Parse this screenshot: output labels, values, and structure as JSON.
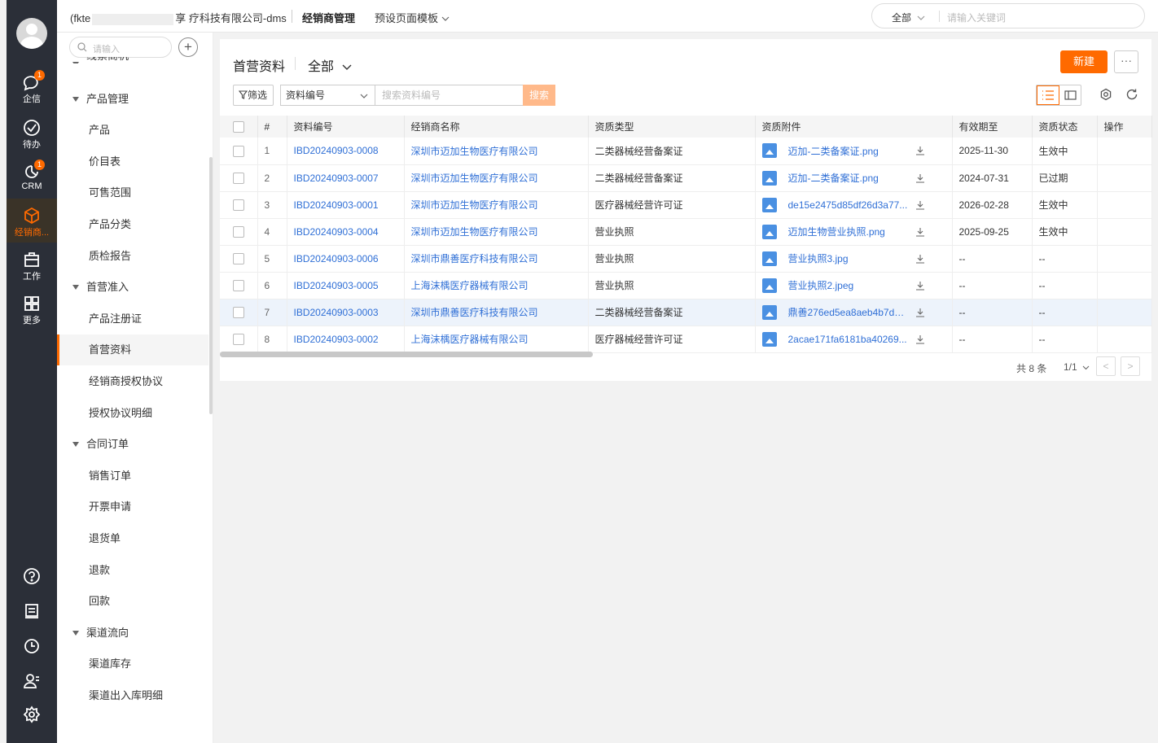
{
  "topbar": {
    "company_prefix": "(fkte",
    "company_suffix": "享 疗科技有限公司-dms",
    "nav_active": "经销商管理",
    "nav_template": "预设页面模板",
    "search_scope": "全部",
    "search_placeholder": "请输入关键词"
  },
  "rail": {
    "items": [
      {
        "label": "企信",
        "badge": "1"
      },
      {
        "label": "待办"
      },
      {
        "label": "CRM",
        "badge": "1"
      },
      {
        "label": "经销商..."
      },
      {
        "label": "工作"
      },
      {
        "label": "更多"
      }
    ]
  },
  "sidebar": {
    "search_placeholder": "请输入",
    "add_label": "+",
    "items": [
      {
        "label": "线索商机",
        "type": "group"
      },
      {
        "label": "产品管理",
        "type": "group"
      },
      {
        "label": "产品",
        "type": "child"
      },
      {
        "label": "价目表",
        "type": "child"
      },
      {
        "label": "可售范围",
        "type": "child"
      },
      {
        "label": "产品分类",
        "type": "child"
      },
      {
        "label": "质检报告",
        "type": "child"
      },
      {
        "label": "首营准入",
        "type": "group"
      },
      {
        "label": "产品注册证",
        "type": "child"
      },
      {
        "label": "首营资料",
        "type": "child",
        "active": true
      },
      {
        "label": "经销商授权协议",
        "type": "child"
      },
      {
        "label": "授权协议明细",
        "type": "child"
      },
      {
        "label": "合同订单",
        "type": "group"
      },
      {
        "label": "销售订单",
        "type": "child"
      },
      {
        "label": "开票申请",
        "type": "child"
      },
      {
        "label": "退货单",
        "type": "child"
      },
      {
        "label": "退款",
        "type": "child"
      },
      {
        "label": "回款",
        "type": "child"
      },
      {
        "label": "渠道流向",
        "type": "group"
      },
      {
        "label": "渠道库存",
        "type": "child"
      },
      {
        "label": "渠道出入库明细",
        "type": "child"
      }
    ]
  },
  "main": {
    "title": "首营资料",
    "view": "全部",
    "new_label": "新建",
    "more_label": "···",
    "filter_label": "筛选",
    "field_select": "资料编号",
    "search_placeholder": "搜索资料编号",
    "search_label": "搜索"
  },
  "table": {
    "columns": [
      "#",
      "资料编号",
      "经销商名称",
      "资质类型",
      "资质附件",
      "有效期至",
      "资质状态",
      "操作"
    ],
    "rows": [
      {
        "no": "1",
        "code": "IBD20240903-0008",
        "dealer": "深圳市迈加生物医疗有限公司",
        "type": "二类器械经营备案证",
        "file": "迈加-二类备案证.png",
        "expire": "2025-11-30",
        "status": "生效中"
      },
      {
        "no": "2",
        "code": "IBD20240903-0007",
        "dealer": "深圳市迈加生物医疗有限公司",
        "type": "二类器械经营备案证",
        "file": "迈加-二类备案证.png",
        "expire": "2024-07-31",
        "status": "已过期"
      },
      {
        "no": "3",
        "code": "IBD20240903-0001",
        "dealer": "深圳市迈加生物医疗有限公司",
        "type": "医疗器械经营许可证",
        "file": "de15e2475d85df26d3a77...",
        "expire": "2026-02-28",
        "status": "生效中"
      },
      {
        "no": "4",
        "code": "IBD20240903-0004",
        "dealer": "深圳市迈加生物医疗有限公司",
        "type": "营业执照",
        "file": "迈加生物营业执照.png",
        "expire": "2025-09-25",
        "status": "生效中"
      },
      {
        "no": "5",
        "code": "IBD20240903-0006",
        "dealer": "深圳市鼎善医疗科技有限公司",
        "type": "营业执照",
        "file": "营业执照3.jpg",
        "expire": "--",
        "status": "--"
      },
      {
        "no": "6",
        "code": "IBD20240903-0005",
        "dealer": "上海沫楀医疗器械有限公司",
        "type": "营业执照",
        "file": "营业执照2.jpeg",
        "expire": "--",
        "status": "--"
      },
      {
        "no": "7",
        "code": "IBD20240903-0003",
        "dealer": "深圳市鼎善医疗科技有限公司",
        "type": "二类器械经营备案证",
        "file": "鼎善276ed5ea8aeb4b7d4....",
        "expire": "--",
        "status": "--"
      },
      {
        "no": "8",
        "code": "IBD20240903-0002",
        "dealer": "上海沫楀医疗器械有限公司",
        "type": "医疗器械经营许可证",
        "file": "2acae171fa6181ba40269...",
        "expire": "--",
        "status": "--"
      }
    ],
    "highlight_row": 7
  },
  "pager": {
    "total": "共 8 条",
    "page": "1/1",
    "prev": "<",
    "next": ">"
  },
  "colors": {
    "accent": "#ff6a00",
    "link": "#2f6fd6",
    "rail_bg": "#2b2f38"
  }
}
